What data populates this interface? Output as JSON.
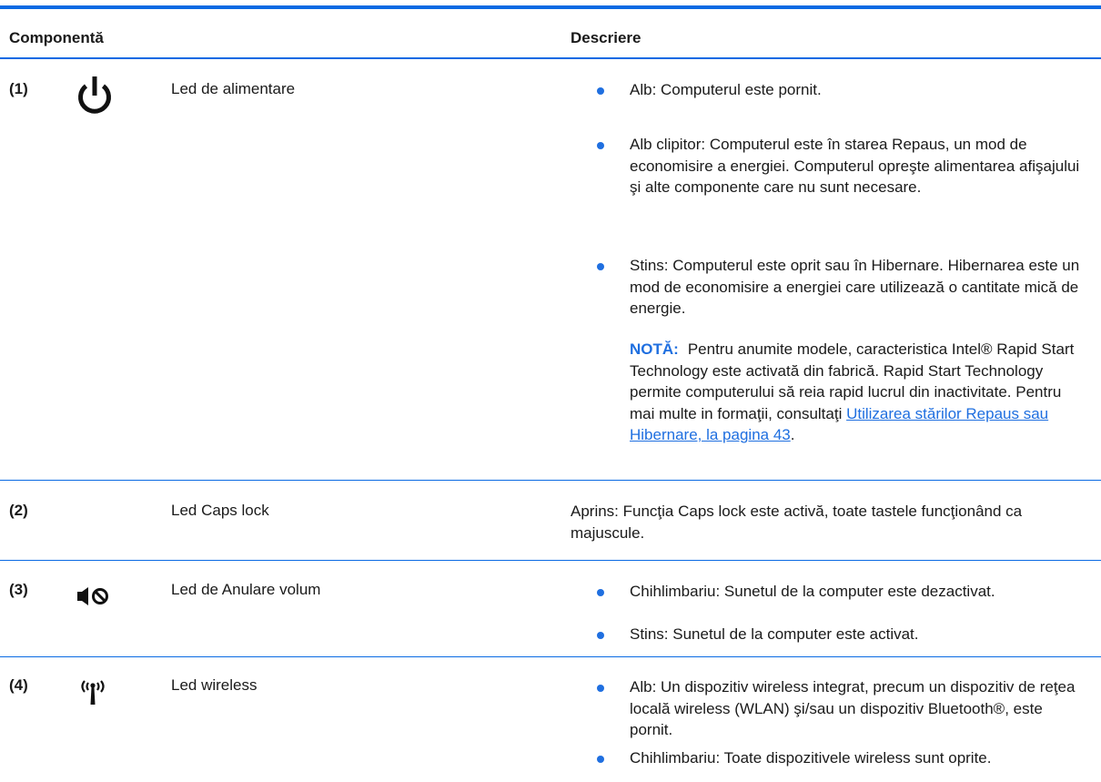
{
  "header": {
    "component": "Componentă",
    "description": "Descriere"
  },
  "rows": [
    {
      "number": "(1)",
      "icon": "power-icon",
      "name": "Led de alimentare",
      "bullets": [
        "Alb: Computerul este pornit.",
        "Alb clipitor: Computerul este în starea Repaus, un mod de economisire a energiei. Computerul opreşte alimentarea afişajului şi alte componente care nu sunt necesare.",
        "Stins: Computerul este oprit sau în Hibernare. Hibernarea este un mod de economisire a energiei care utilizează o cantitate mică de energie."
      ],
      "note": {
        "label": "NOTĂ:",
        "text": "Pentru anumite modele, caracteristica Intel® Rapid Start Technology este activată din fabrică. Rapid Start Technology permite computerului să reia rapid lucrul din inactivitate. Pentru mai multe in formaţii, consultaţi ",
        "link": "Utilizarea stărilor Repaus sau Hibernare, la pagina 43",
        "suffix": "."
      }
    },
    {
      "number": "(2)",
      "name": "Led Caps lock",
      "description": "Aprins: Funcţia Caps lock este activă, toate tastele funcţionând ca majuscule."
    },
    {
      "number": "(3)",
      "icon": "mute-icon",
      "name": "Led de Anulare volum",
      "bullets": [
        "Chihlimbariu: Sunetul de la computer este dezactivat.",
        "Stins: Sunetul de la computer este activat."
      ]
    },
    {
      "number": "(4)",
      "icon": "wireless-icon",
      "name": "Led wireless",
      "bullets": [
        "Alb: Un dispozitiv wireless integrat, precum un dispozitiv de reţea locală wireless (WLAN) şi/sau un dispozitiv Bluetooth®, este pornit.",
        "Chihlimbariu: Toate dispozitivele wireless sunt oprite."
      ]
    }
  ],
  "colors": {
    "accent": "#0a6ae3",
    "bullet": "#1f6fe0",
    "text": "#1a1a1a"
  }
}
